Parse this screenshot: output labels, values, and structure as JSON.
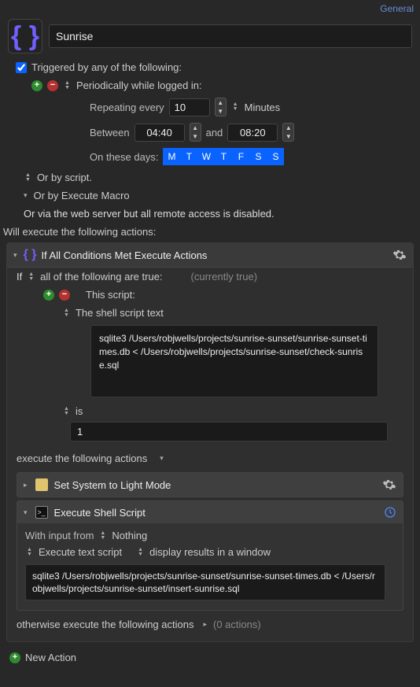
{
  "top_link": "General",
  "title": "Sunrise",
  "trigger": {
    "checkbox_checked": true,
    "label": "Triggered by any of the following:",
    "periodic_label": "Periodically while logged in:",
    "repeat_label": "Repeating every",
    "repeat_value": "10",
    "repeat_unit": "Minutes",
    "between_label": "Between",
    "time_from": "04:40",
    "and": "and",
    "time_to": "08:20",
    "days_label": "On these days:",
    "days": [
      "M",
      "T",
      "W",
      "T",
      "F",
      "S",
      "S"
    ]
  },
  "or_script": "Or by script.",
  "or_macro": "Or by Execute Macro",
  "or_web": "Or via the web server but all remote access is disabled.",
  "exec_label": "Will execute the following actions:",
  "cond": {
    "title": "If All Conditions Met Execute Actions",
    "if_label": "If",
    "if_mode": "all of the following are true:",
    "current": "(currently true)",
    "this_script": "This script:",
    "shell_text_label": "The shell script text",
    "script1": "sqlite3 /Users/robjwells/projects/sunrise-sunset/sunrise-sunset-times.db < /Users/robjwells/projects/sunrise-sunset/check-sunrise.sql",
    "is_label": "is",
    "is_value": "1",
    "exec_actions_label": "execute the following actions",
    "action1": "Set System to Light Mode",
    "action2_title": "Execute Shell Script",
    "input_label": "With input from",
    "input_mode": "Nothing",
    "exec_text_script": "Execute text script",
    "display_results": "display results in a window",
    "script2": "sqlite3 /Users/robjwells/projects/sunrise-sunset/sunrise-sunset-times.db < /Users/robjwells/projects/sunrise-sunset/insert-sunrise.sql",
    "otherwise": "otherwise execute the following actions",
    "otherwise_count": "(0 actions)"
  },
  "new_action": "New Action"
}
